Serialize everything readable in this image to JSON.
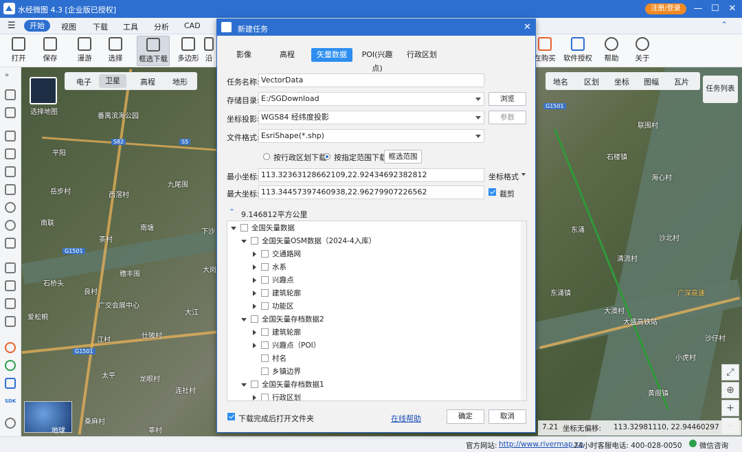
{
  "app": {
    "title": "水经微图 4.3 [企业版已授权]",
    "login_label": "注册/登录",
    "window_controls": [
      "—",
      "☐",
      "✕"
    ]
  },
  "menu": {
    "items": [
      "开始",
      "视图",
      "下载",
      "工具",
      "分析",
      "CAD"
    ]
  },
  "ribbon": {
    "items": [
      "打开",
      "保存",
      "漫游",
      "选择",
      "框选下载",
      "多边形",
      "沿"
    ],
    "right_items": [
      "在购买",
      "软件授权",
      "帮助",
      "关于"
    ]
  },
  "map": {
    "type_tabs": [
      "电子",
      "卫星",
      "高程",
      "地形"
    ],
    "layer_tabs": [
      "地名",
      "区划",
      "坐标",
      "图幅",
      "瓦片"
    ],
    "task_list_label": "任务列表",
    "select_map_label": "选择地图",
    "globe_label": "地球",
    "places": [
      "平阳",
      "岳步村",
      "西滘村",
      "南联",
      "九尾围",
      "南塘",
      "茶村",
      "石桥头",
      "穗丰围",
      "良村",
      "爱松桐",
      "江村",
      "仕陂村",
      "太平",
      "龙眼村",
      "连社村",
      "桑麻村",
      "莘村",
      "大江",
      "联围村",
      "石楼镇",
      "海心村",
      "沙北村",
      "清流村",
      "东涌镇",
      "大澳村",
      "沙仔村",
      "小虎村",
      "黄阁镇",
      "东涌",
      "下沙",
      "大岗"
    ],
    "road_shields": [
      "S82",
      "S5",
      "G1501",
      "G1501",
      "G1501"
    ],
    "landmarks": [
      "番禺滨海公园",
      "广交会展中心",
      "广深高速",
      "大盛高铁站"
    ],
    "coord_bar": {
      "zoom": "7.21",
      "offset_label": "坐标无偏移:",
      "coords": "113.32981110, 22.94460297"
    },
    "zoom_controls": [
      "⤢",
      "⊕",
      "+",
      "−"
    ]
  },
  "status": {
    "site_label": "官方网站:",
    "site_url": "http://www.rivermap.cn",
    "hotline": "24小时客服电话: 400-028-0050",
    "wechat": "微信咨询"
  },
  "dialog": {
    "title": "新建任务",
    "tabs": [
      "影像",
      "高程",
      "矢量数据",
      "POI(兴趣点)",
      "行政区划"
    ],
    "active_tab": "矢量数据",
    "task_name_label": "任务名称:",
    "task_name": "VectorData",
    "save_dir_label": "存储目录:",
    "save_dir": "E:/SGDownload",
    "browse_label": "浏览",
    "projection_label": "坐标投影:",
    "projection": "WGS84 经纬度投影",
    "params_label": "参数",
    "format_label": "文件格式:",
    "format": "EsriShape(*.shp)",
    "radio_admin": "按行政区划下载",
    "radio_range": "按指定范围下载",
    "range_select_label": "框选范围",
    "min_coord_label": "最小坐标:",
    "min_coord": "113.32363128662109,22.92434692382812",
    "coord_format_label": "坐标格式",
    "max_coord_label": "最大坐标:",
    "max_coord": "113.34457397460938,22.96279907226562",
    "clip_label": "裁剪",
    "area": "9.146812平方公里",
    "tree": {
      "root": "全国矢量数据",
      "g1": "全国矢量OSM数据（2024-4入库）",
      "g1_items": [
        "交通路网",
        "水系",
        "兴趣点",
        "建筑轮廓",
        "功能区"
      ],
      "g2": "全国矢量存档数据2",
      "g2_items": [
        "建筑轮廓",
        "兴趣点（POI）",
        "村名",
        "乡镇边界"
      ],
      "g3": "全国矢量存档数据1",
      "g3_items": [
        "行政区划"
      ]
    },
    "open_folder_label": "下载完成后打开文件夹",
    "help_label": "在线帮助",
    "ok_label": "确定",
    "cancel_label": "取消"
  }
}
